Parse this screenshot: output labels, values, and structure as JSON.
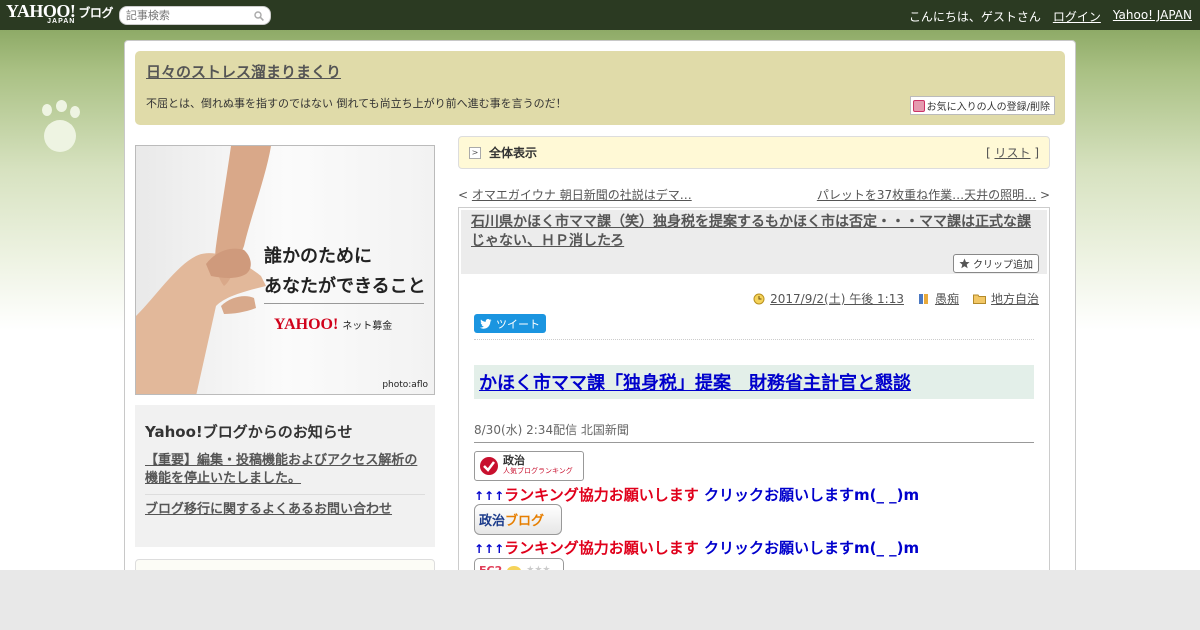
{
  "topbar": {
    "logo": "YAHOO!",
    "logo_japan": "JAPAN",
    "logo_blog": "ブログ",
    "search_placeholder": "記事検索",
    "greeting": "こんにちは、ゲストさん",
    "login": "ログイン",
    "yahoo_japan": "Yahoo! JAPAN"
  },
  "header": {
    "title": "日々のストレス溜まりまくり",
    "description": "不屈とは、倒れぬ事を指すのではない 倒れても尚立ち上がり前へ進む事を言うのだ！",
    "fav_button": "お気に入りの人の登録/削除"
  },
  "ad": {
    "line1": "誰かのために",
    "line2": "あなたができること",
    "logo": "YAHOO!",
    "logo_sub": "ネット募金",
    "credit": "photo:aflo"
  },
  "notice": {
    "title": "Yahoo!ブログからのお知らせ",
    "links": [
      "【重要】編集・投稿機能およびアクセス解析の機能を停止いたしました。",
      "ブログ移行に関するよくあるお問い合わせ"
    ]
  },
  "nav": {
    "all_view": "全体表示",
    "list_label": "リスト",
    "prev": "オマエガイウナ 朝日新聞の社説はデマ…",
    "next": "パレットを37枚重ね作業…天井の照明…"
  },
  "article": {
    "title": "石川県かほく市ママ課（笑）独身税を提案するもかほく市は否定・・・ママ課は正式な課じゃない、ＨＰ消したろ",
    "clip_button": "クリップ追加",
    "date": "2017/9/2(土) 午後 1:13",
    "author": "愚痴",
    "category": "地方自治",
    "tweet": "ツイート",
    "headline": "かほく市ママ課「独身税」提案　財務省主計官と懇談",
    "source": "8/30(水) 2:34配信 北国新聞",
    "banner1_main": "政治",
    "banner1_sub": "人気ブログランキング",
    "banner2_a": "政治",
    "banner2_b": "ブログ",
    "banner3": "FC2",
    "rank_arrows": "↑↑↑",
    "rank_red": "ランキング協力お願いします",
    "rank_blue": " クリックお願いしますm(_ _)m"
  },
  "colors": {
    "topbar_bg": "#2b3a22",
    "header_bg": "#e0dba9",
    "headline_bg": "#e3efe9",
    "rank_red": "#e0001b",
    "rank_blue": "#0000cc"
  }
}
